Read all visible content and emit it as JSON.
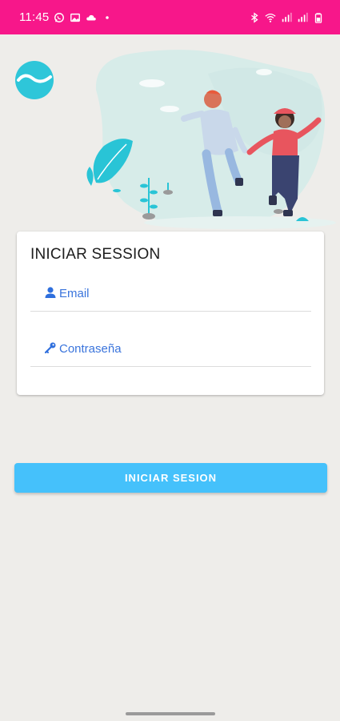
{
  "status_bar": {
    "time": "11:45",
    "left_icons": [
      "whatsapp-icon",
      "gallery-icon",
      "cloud-icon",
      "dot-icon"
    ],
    "right_icons": [
      "bluetooth-icon",
      "wifi-icon",
      "signal-icon",
      "signal-icon",
      "battery-icon"
    ],
    "background": "#f7178a"
  },
  "login": {
    "title": "INICIAR SESSION",
    "email_placeholder": "Email",
    "email_icon": "person-icon",
    "password_placeholder": "Contraseña",
    "password_icon": "key-icon",
    "button_label": "INICIAR SESION",
    "button_color": "#45c1fb",
    "accent_color": "#2f6fdd"
  }
}
